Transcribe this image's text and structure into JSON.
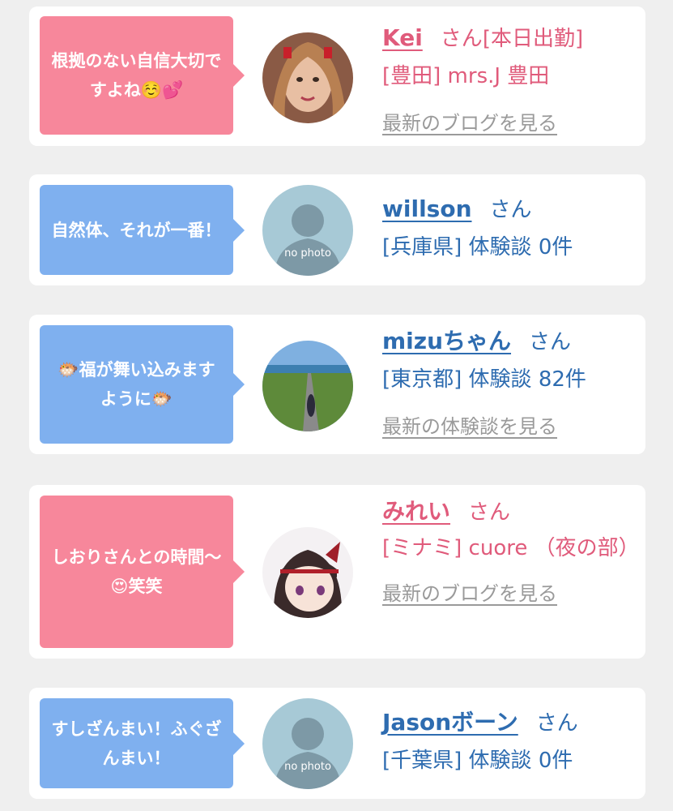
{
  "cards": [
    {
      "message": "根拠のない自信大切ですよね☺️💕",
      "name": "Kei",
      "honorific": "さん",
      "status": "[本日出勤]",
      "detail": "[豊田] mrs.J 豊田",
      "link": "最新のブログを見る",
      "theme": "pink"
    },
    {
      "message": "自然体、それが一番！",
      "name": "willson",
      "honorific": "さん",
      "detail": "[兵庫県] 体験談 0件",
      "no_photo": "no photo",
      "theme": "blue"
    },
    {
      "message": "🐡福が舞い込みますように🐡",
      "name": "mizuちゃん",
      "honorific": "さん",
      "detail": "[東京都] 体験談 82件",
      "link": "最新の体験談を見る",
      "theme": "blue"
    },
    {
      "message": "しおりさんとの時間〜😍笑笑",
      "name": "みれい",
      "honorific": "さん",
      "detail": "[ミナミ] cuore （夜の部）",
      "link": "最新のブログを見る",
      "theme": "pink"
    },
    {
      "message": "すしざんまい！ふぐざんまい！",
      "name": "Jasonボーン",
      "honorific": "さん",
      "detail": "[千葉県] 体験談 0件",
      "no_photo": "no photo",
      "theme": "blue"
    }
  ],
  "colors": {
    "pink": "#f7879b",
    "blue": "#7fb0ef",
    "pink_text": "#e05b7b",
    "blue_text": "#2e6cb0"
  }
}
